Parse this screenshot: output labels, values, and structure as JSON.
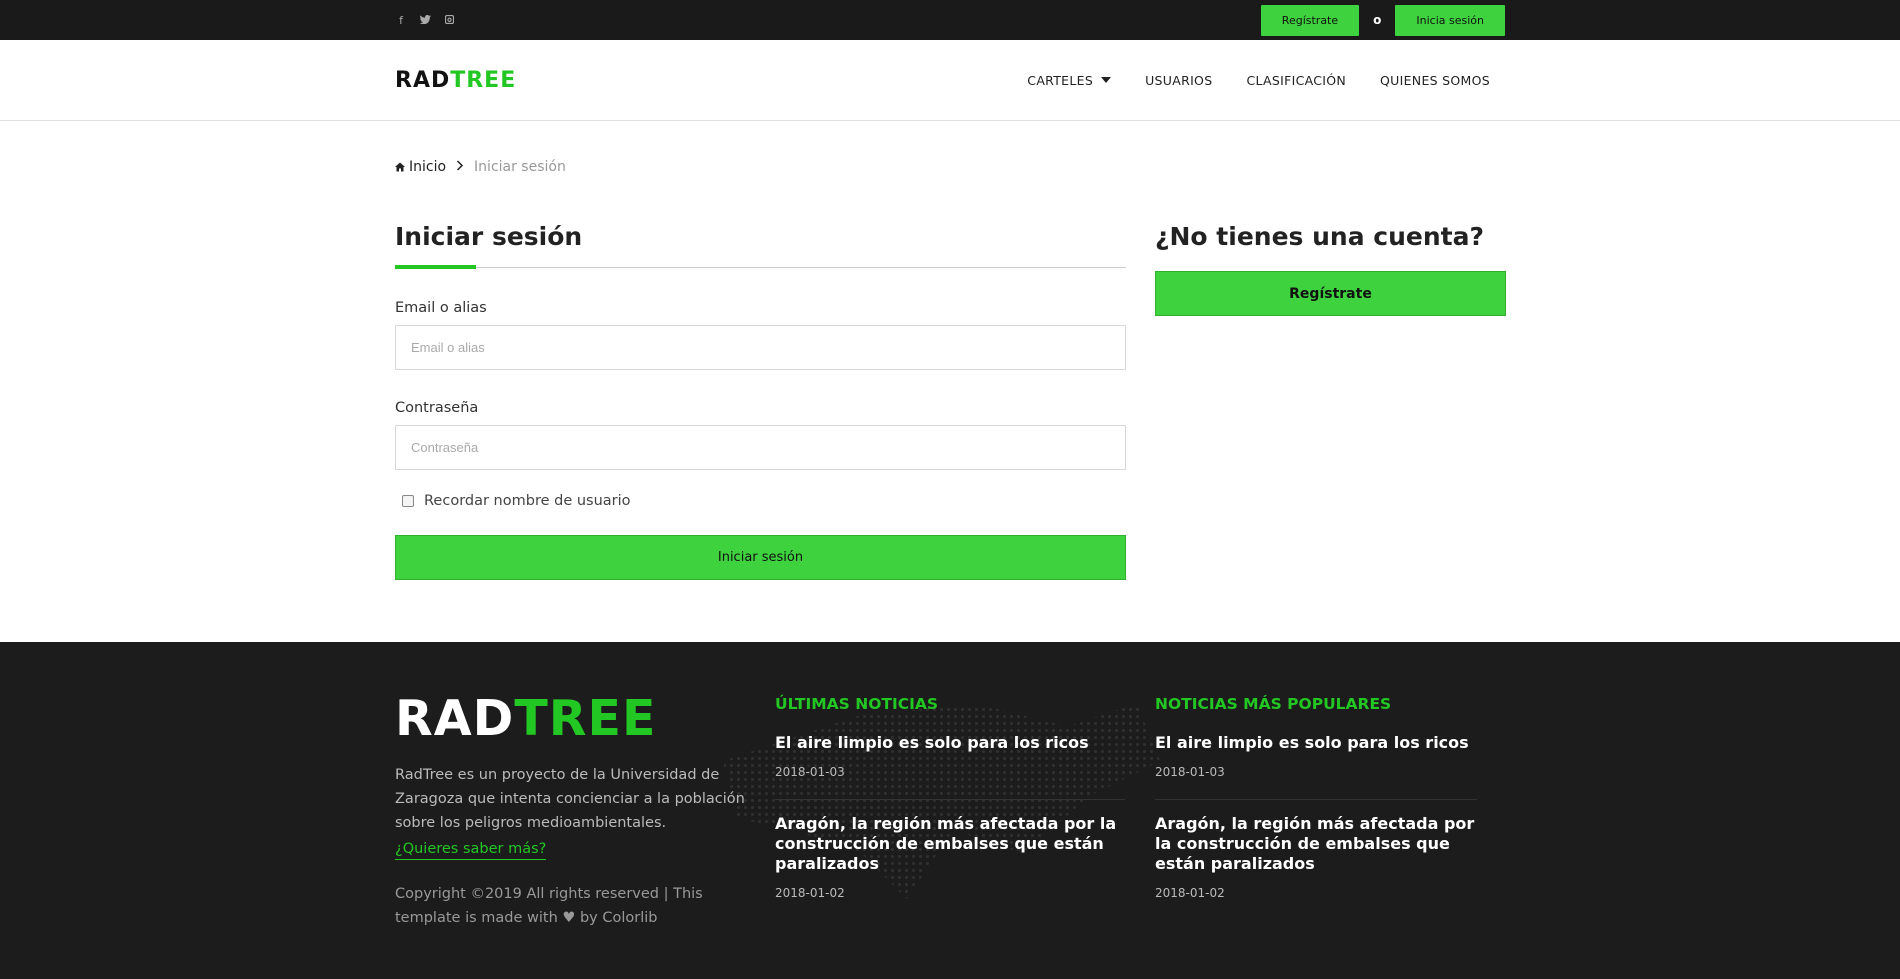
{
  "topbar": {
    "social": [
      "f",
      "t",
      "ig"
    ],
    "register_label": "Regístrate",
    "or_label": "o",
    "login_label": "Inicia sesión"
  },
  "header": {
    "logo_rad": "RAD",
    "logo_tree": "TREE",
    "nav": [
      "CARTELES",
      "USUARIOS",
      "CLASIFICACIÓN",
      "QUIENES SOMOS"
    ]
  },
  "breadcrumb": {
    "home": "Inicio",
    "current": "Iniciar sesión"
  },
  "login": {
    "title": "Iniciar sesión",
    "email_label": "Email o alias",
    "email_placeholder": "Email o alias",
    "password_label": "Contraseña",
    "password_placeholder": "Contraseña",
    "remember_label": "Recordar nombre de usuario",
    "submit_label": "Iniciar sesión"
  },
  "signup": {
    "title": "¿No tienes una cuenta?",
    "button_label": "Regístrate"
  },
  "footer": {
    "logo_rad": "RAD",
    "logo_tree": "TREE",
    "description": "RadTree es un proyecto de la Universidad de Zaragoza que intenta concienciar a la población sobre los peligros medioambientales.",
    "more_link": "¿Quieres saber más?",
    "copyright": "Copyright ©2019 All rights reserved | This template is made with ♥ by Colorlib",
    "latest_heading": "ÚLTIMAS NOTICIAS",
    "popular_heading": "NOTICIAS MÁS POPULARES",
    "latest": [
      {
        "title": "El aire limpio es solo para los ricos",
        "date": "2018-01-03"
      },
      {
        "title": "Aragón, la región más afectada por la construcción de embalses que están paralizados",
        "date": "2018-01-02"
      }
    ],
    "popular": [
      {
        "title": "El aire limpio es solo para los ricos",
        "date": "2018-01-03"
      },
      {
        "title": "Aragón, la región más afectada por la construcción de embalses que están paralizados",
        "date": "2018-01-02"
      }
    ]
  },
  "colors": {
    "accent": "#3ed33e",
    "logo_green": "#23c723",
    "dark": "#1a1a1a"
  }
}
